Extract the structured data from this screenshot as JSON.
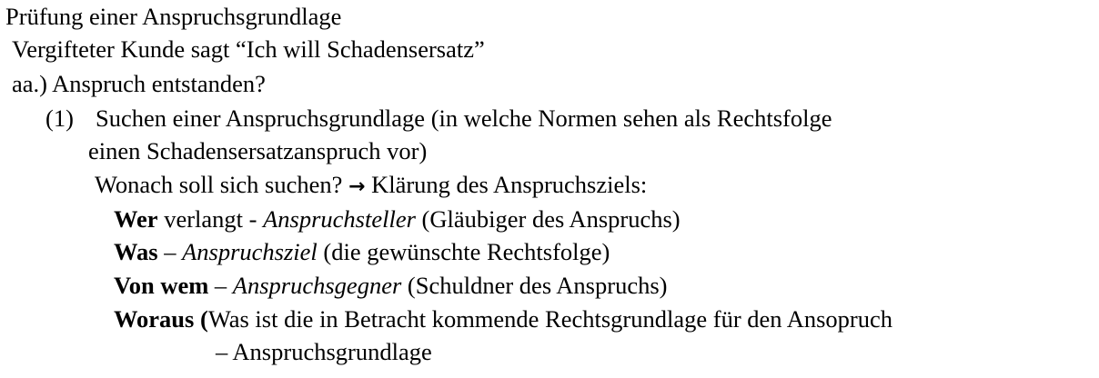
{
  "document": {
    "heading": "Prüfung einer Anspruchsgrundlage",
    "case_line": "Vergifteter Kunde sagt “Ich will Schadensersatz”",
    "point_aa": "aa.) Anspruch entstanden?",
    "item_1": {
      "number": "(1)",
      "text": "Suchen einer Anspruchsgrundlage (in welche Normen sehen als Rechtsfolge",
      "continuation": "einen Schadensersatzanspruch vor)"
    },
    "question": {
      "before_arrow": "Wonach soll sich suchen?",
      "arrow": "→",
      "after_arrow": " Klärung des Anspruchsziels:"
    },
    "criteria": [
      {
        "term": "Wer",
        "sep": " verlangt - ",
        "role": "Anspruchsteller",
        "detail": " (Gläubiger des Anspruchs)"
      },
      {
        "term": "Was",
        "sep": " – ",
        "role": "Anspruchsziel",
        "detail": " (die gewünschte Rechtsfolge)"
      },
      {
        "term": "Von wem",
        "sep": " – ",
        "role": "Anspruchsgegner",
        "detail": " (Schuldner des Anspruchs)"
      },
      {
        "term": "Woraus (",
        "detail": "Was ist die in Betracht kommende Rechtsgrundlage für den Ansopruch"
      }
    ],
    "final_line": "– Anspruchsgrundlage"
  }
}
